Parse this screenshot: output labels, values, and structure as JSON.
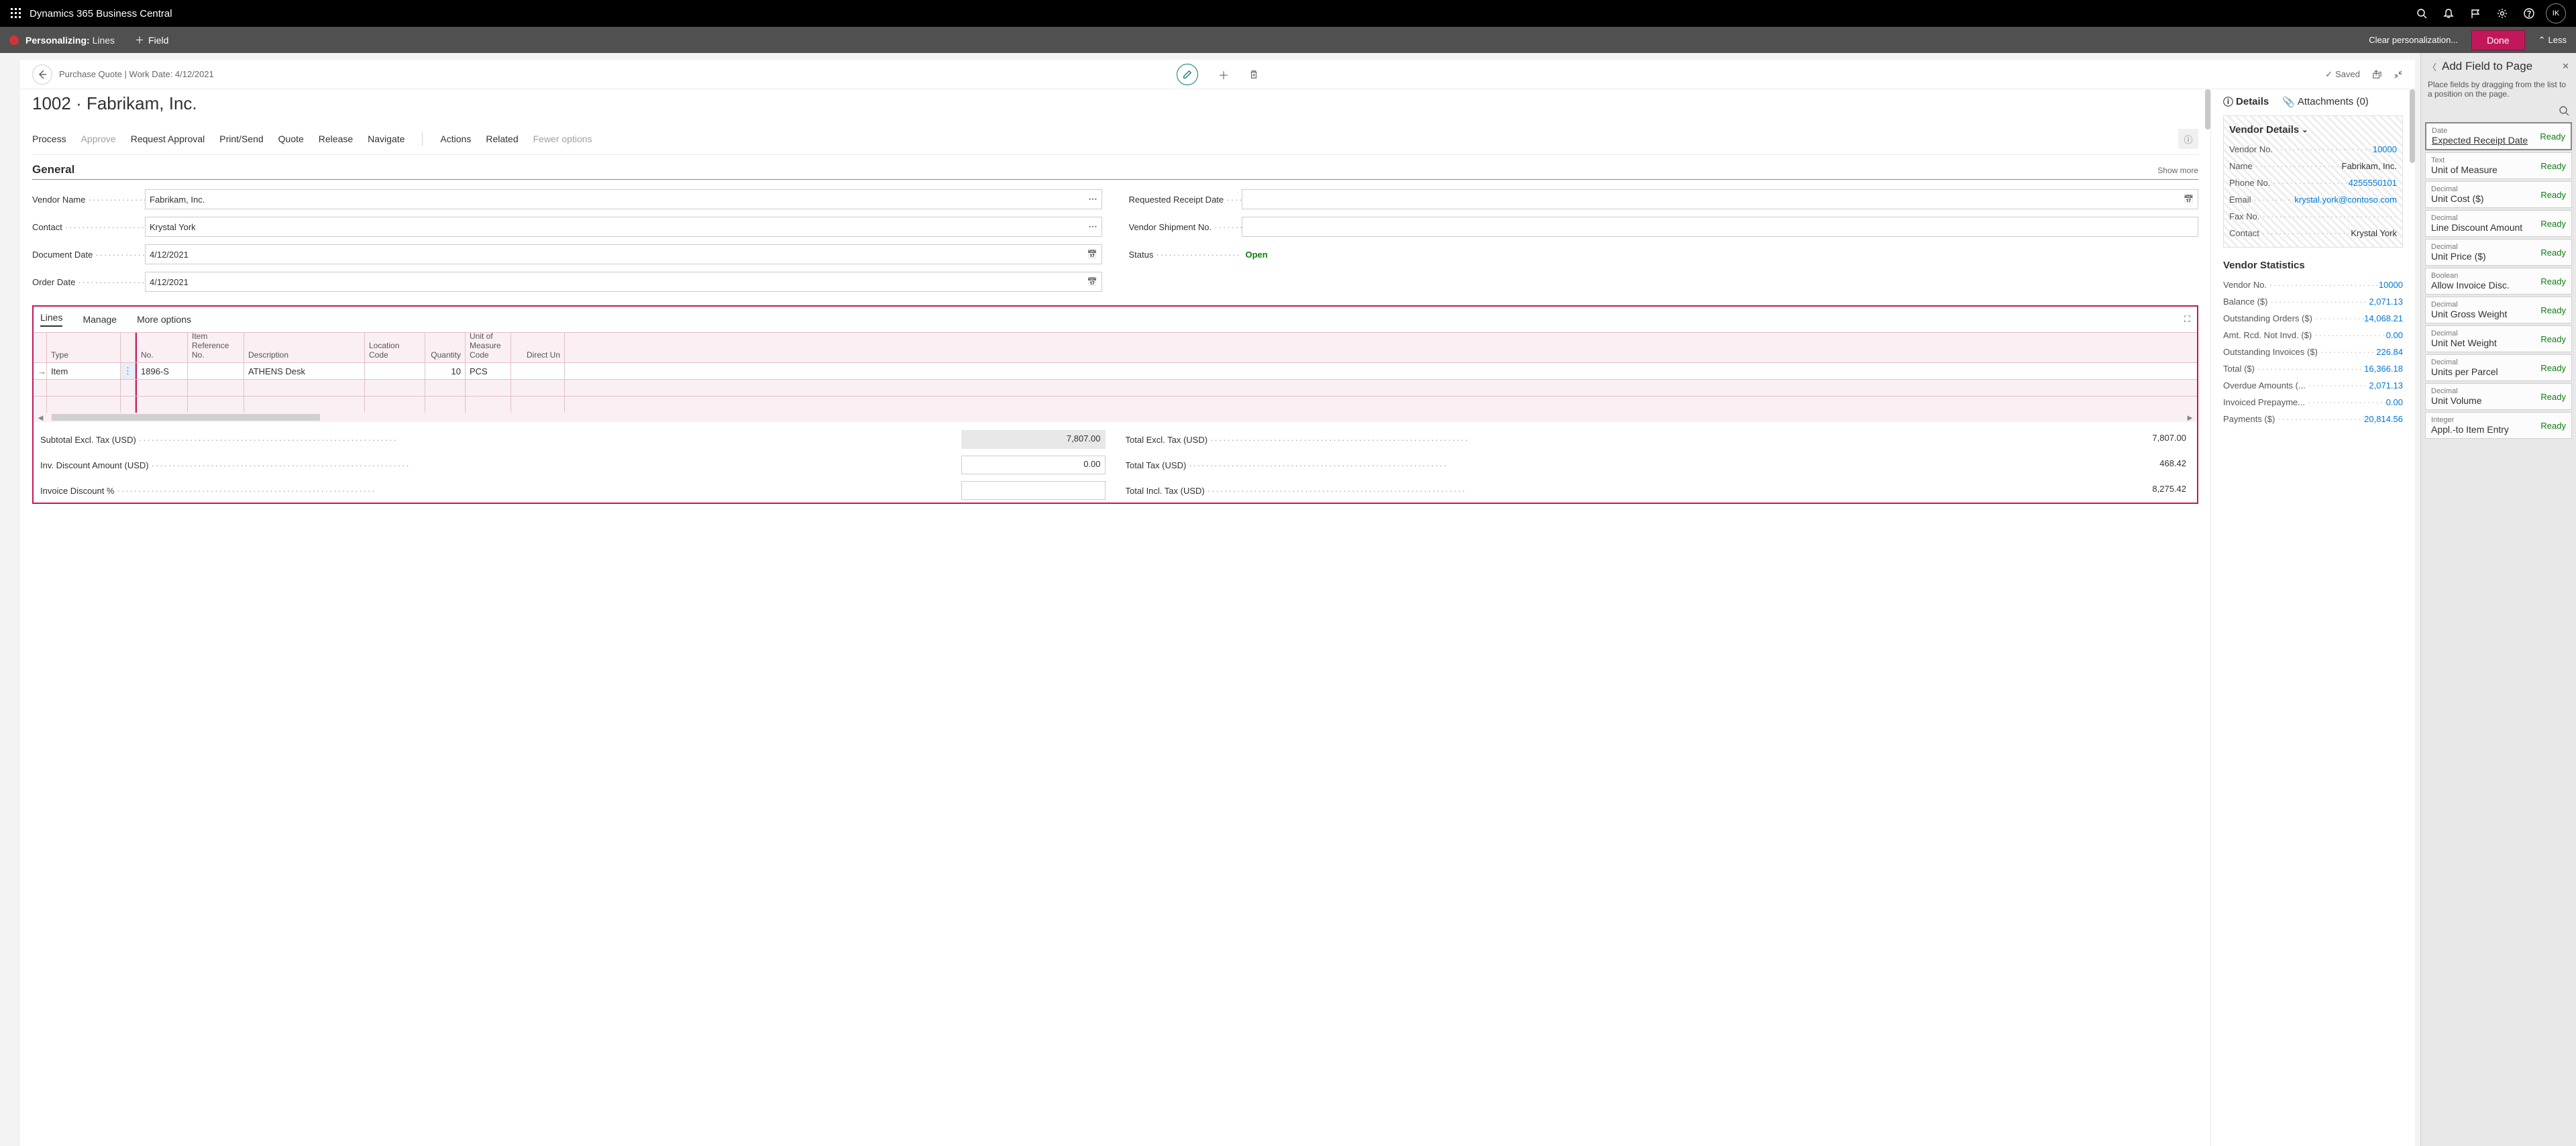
{
  "topbar": {
    "brand": "Dynamics 365 Business Central",
    "avatar": "IK"
  },
  "personalize": {
    "title": "Personalizing:",
    "sub": "Lines",
    "add_field": "Field",
    "clear": "Clear personalization...",
    "done": "Done",
    "less": "Less"
  },
  "header": {
    "breadcrumb": "Purchase Quote | Work Date: 4/12/2021",
    "saved": "Saved"
  },
  "page_title": "1002 · Fabrikam, Inc.",
  "actions": {
    "process": "Process",
    "approve": "Approve",
    "request_approval": "Request Approval",
    "print_send": "Print/Send",
    "quote": "Quote",
    "release": "Release",
    "navigate": "Navigate",
    "actions": "Actions",
    "related": "Related",
    "fewer": "Fewer options"
  },
  "general": {
    "heading": "General",
    "show_more": "Show more",
    "vendor_name_lbl": "Vendor Name",
    "vendor_name": "Fabrikam, Inc.",
    "contact_lbl": "Contact",
    "contact": "Krystal York",
    "doc_date_lbl": "Document Date",
    "doc_date": "4/12/2021",
    "order_date_lbl": "Order Date",
    "order_date": "4/12/2021",
    "req_receipt_lbl": "Requested Receipt Date",
    "req_receipt": "",
    "vendor_ship_lbl": "Vendor Shipment No.",
    "vendor_ship": "",
    "status_lbl": "Status",
    "status": "Open"
  },
  "lines": {
    "tab_lines": "Lines",
    "tab_manage": "Manage",
    "tab_more": "More options",
    "cols": {
      "type": "Type",
      "no": "No.",
      "ref": "Item Reference No.",
      "desc": "Description",
      "loc": "Location Code",
      "qty": "Quantity",
      "uom": "Unit of Measure Code",
      "cost": "Direct Un"
    },
    "row": {
      "type": "Item",
      "no": "1896-S",
      "desc": "ATHENS Desk",
      "qty": "10",
      "uom": "PCS"
    },
    "totals": {
      "subtotal_lbl": "Subtotal Excl. Tax (USD)",
      "subtotal": "7,807.00",
      "inv_disc_amt_lbl": "Inv. Discount Amount (USD)",
      "inv_disc_amt": "0.00",
      "inv_disc_pct_lbl": "Invoice Discount %",
      "inv_disc_pct": "",
      "total_excl_lbl": "Total Excl. Tax (USD)",
      "total_excl": "7,807.00",
      "total_tax_lbl": "Total Tax (USD)",
      "total_tax": "468.42",
      "total_incl_lbl": "Total Incl. Tax (USD)",
      "total_incl": "8,275.42"
    }
  },
  "factbox": {
    "details_tab": "Details",
    "attachments_tab": "Attachments (0)",
    "vendor_details_hdr": "Vendor Details",
    "vendor_no_lbl": "Vendor No.",
    "vendor_no": "10000",
    "name_lbl": "Name",
    "name": "Fabrikam, Inc.",
    "phone_lbl": "Phone No.",
    "phone": "4255550101",
    "email_lbl": "Email",
    "email": "krystal.york@contoso.com",
    "fax_lbl": "Fax No.",
    "fax": "",
    "contact_lbl": "Contact",
    "contact": "Krystal York",
    "vendor_stats_hdr": "Vendor Statistics",
    "vs_vendor_no_lbl": "Vendor No.",
    "vs_vendor_no": "10000",
    "vs_balance_lbl": "Balance ($)",
    "vs_balance": "2,071.13",
    "vs_outstanding_orders_lbl": "Outstanding Orders ($)",
    "vs_outstanding_orders": "14,068.21",
    "vs_amt_rcd_lbl": "Amt. Rcd. Not Invd. ($)",
    "vs_amt_rcd": "0.00",
    "vs_outstanding_inv_lbl": "Outstanding Invoices ($)",
    "vs_outstanding_inv": "226.84",
    "vs_total_lbl": "Total ($)",
    "vs_total": "16,366.18",
    "vs_overdue_lbl": "Overdue Amounts (...",
    "vs_overdue": "2,071.13",
    "vs_prepay_lbl": "Invoiced Prepayme...",
    "vs_prepay": "0.00",
    "vs_payments_lbl": "Payments ($)",
    "vs_payments": "20,814.56"
  },
  "field_panel": {
    "title": "Add Field to Page",
    "desc": "Place fields by dragging from the list to a position on the page.",
    "items": [
      {
        "type": "Date",
        "name": "Expected Receipt Date",
        "status": "Ready"
      },
      {
        "type": "Text",
        "name": "Unit of Measure",
        "status": "Ready"
      },
      {
        "type": "Decimal",
        "name": "Unit Cost ($)",
        "status": "Ready"
      },
      {
        "type": "Decimal",
        "name": "Line Discount Amount",
        "status": "Ready"
      },
      {
        "type": "Decimal",
        "name": "Unit Price ($)",
        "status": "Ready"
      },
      {
        "type": "Boolean",
        "name": "Allow Invoice Disc.",
        "status": "Ready"
      },
      {
        "type": "Decimal",
        "name": "Unit Gross Weight",
        "status": "Ready"
      },
      {
        "type": "Decimal",
        "name": "Unit Net Weight",
        "status": "Ready"
      },
      {
        "type": "Decimal",
        "name": "Units per Parcel",
        "status": "Ready"
      },
      {
        "type": "Decimal",
        "name": "Unit Volume",
        "status": "Ready"
      },
      {
        "type": "Integer",
        "name": "Appl.-to Item Entry",
        "status": "Ready"
      }
    ]
  }
}
